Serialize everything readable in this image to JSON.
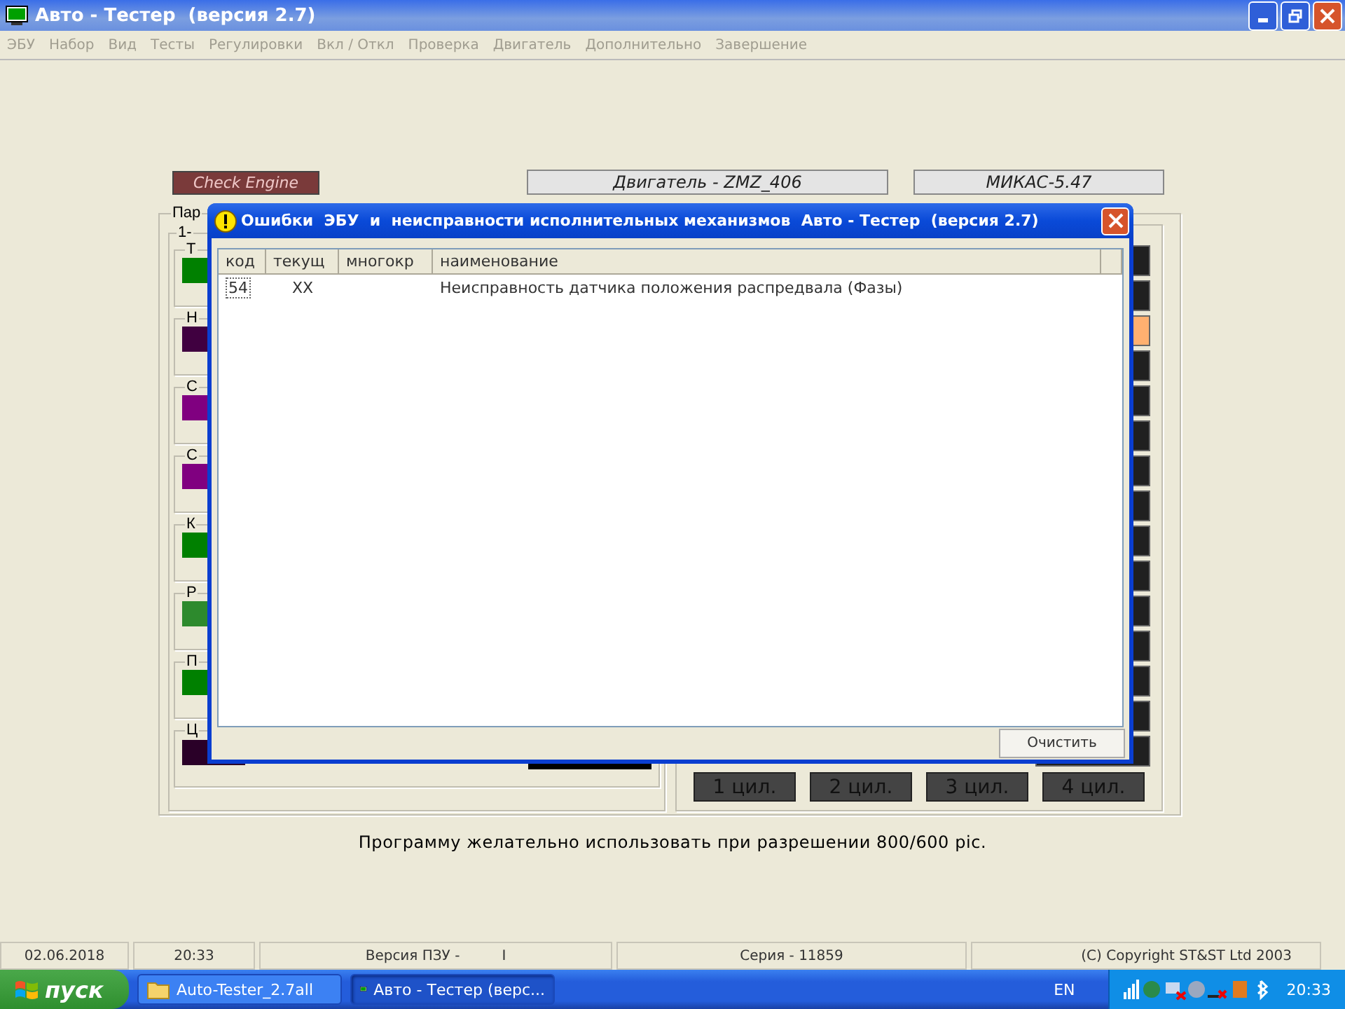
{
  "window": {
    "title": "Авто - Тестер  (версия 2.7)"
  },
  "menu": [
    "ЭБУ",
    "Набор",
    "Вид",
    "Тесты",
    "Регулировки",
    "Вкл / Откл",
    "Проверка",
    "Двигатель",
    "Дополнительно",
    "Завершение"
  ],
  "indicators": {
    "check_engine": "Check Engine",
    "engine": "Двигатель - ZMZ_406",
    "controller": "МИКАС-5.47"
  },
  "params_group": {
    "title": "Пар",
    "subgroup_title": "1-",
    "rows": [
      {
        "label": "Т",
        "color": "#008000"
      },
      {
        "label": "Н",
        "color": "#400040"
      },
      {
        "label": "С",
        "color": "#800080"
      },
      {
        "label": "С",
        "color": "#800080"
      },
      {
        "label": "К",
        "color": "#008000"
      },
      {
        "label": "Р",
        "color": "#2d8a2d"
      },
      {
        "label": "П",
        "color": "#008000"
      },
      {
        "label": "Ц",
        "color": "#2a0028"
      }
    ]
  },
  "cylinders": [
    "1 цил.",
    "2 цил.",
    "3 цил.",
    "4 цил."
  ],
  "dialog": {
    "title": "Ошибки  ЭБУ  и  неисправности исполнительных механизмов  Авто - Тестер  (версия 2.7)",
    "columns": [
      "код",
      "текущ",
      "многокр",
      "наименование"
    ],
    "rows": [
      {
        "code": "54",
        "current": "XX",
        "name": "Неисправность  датчика положения распредвала (Фазы)"
      }
    ],
    "button": "Очистить"
  },
  "note": "Программу желательно использовать при разрешении 800/600 pic.",
  "status_bar": [
    {
      "text": "02.06.2018"
    },
    {
      "text": "20:33"
    },
    {
      "text": "Версия ПЗУ -",
      "extra": "I"
    },
    {
      "text": "Серия - 11859"
    },
    {
      "text": "(C) Copyright  ST&ST  Ltd 2003"
    }
  ],
  "taskbar": {
    "start": "пуск",
    "tasks": [
      {
        "label": "Auto-Tester_2.7all",
        "kind": "folder",
        "selected": false
      },
      {
        "label": "Авто - Тестер  (верс...",
        "kind": "app",
        "selected": true
      }
    ],
    "language": "EN",
    "clock": "20:33"
  }
}
